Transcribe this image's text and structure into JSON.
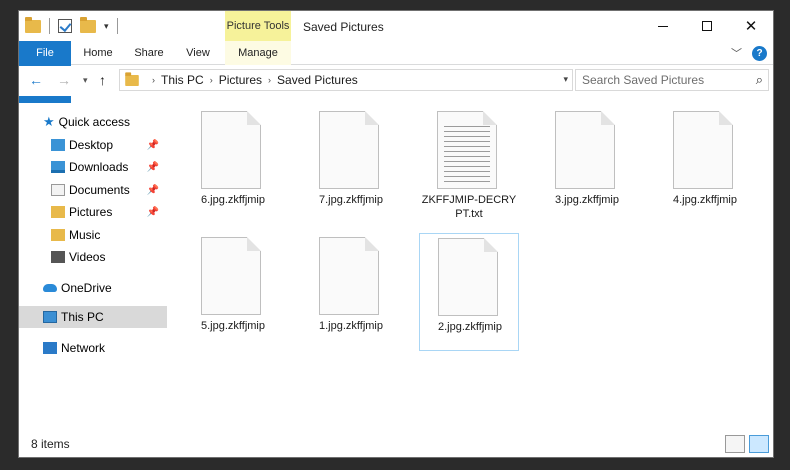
{
  "window": {
    "title": "Saved Pictures",
    "context_tab": "Picture Tools"
  },
  "ribbon": {
    "tabs": [
      "File",
      "Home",
      "Share",
      "View",
      "Manage"
    ]
  },
  "address": {
    "crumbs": [
      "This PC",
      "Pictures",
      "Saved Pictures"
    ]
  },
  "search": {
    "placeholder": "Search Saved Pictures"
  },
  "nav": {
    "quick_access": "Quick access",
    "pinned": [
      "Desktop",
      "Downloads",
      "Documents",
      "Pictures"
    ],
    "others": [
      "Music",
      "Videos"
    ],
    "onedrive": "OneDrive",
    "this_pc": "This PC",
    "network": "Network"
  },
  "files": [
    {
      "name": "6.jpg.zkffjmip",
      "type": "blank"
    },
    {
      "name": "7.jpg.zkffjmip",
      "type": "blank"
    },
    {
      "name": "ZKFFJMIP-DECRYPT.txt",
      "type": "text"
    },
    {
      "name": "3.jpg.zkffjmip",
      "type": "blank"
    },
    {
      "name": "4.jpg.zkffjmip",
      "type": "blank"
    },
    {
      "name": "5.jpg.zkffjmip",
      "type": "blank"
    },
    {
      "name": "1.jpg.zkffjmip",
      "type": "blank"
    },
    {
      "name": "2.jpg.zkffjmip",
      "type": "blank"
    }
  ],
  "status": {
    "count": "8 items"
  },
  "colors": {
    "accent": "#1979ca",
    "context_tab": "#f6f29a",
    "selected_nav": "#d9d9d9"
  }
}
